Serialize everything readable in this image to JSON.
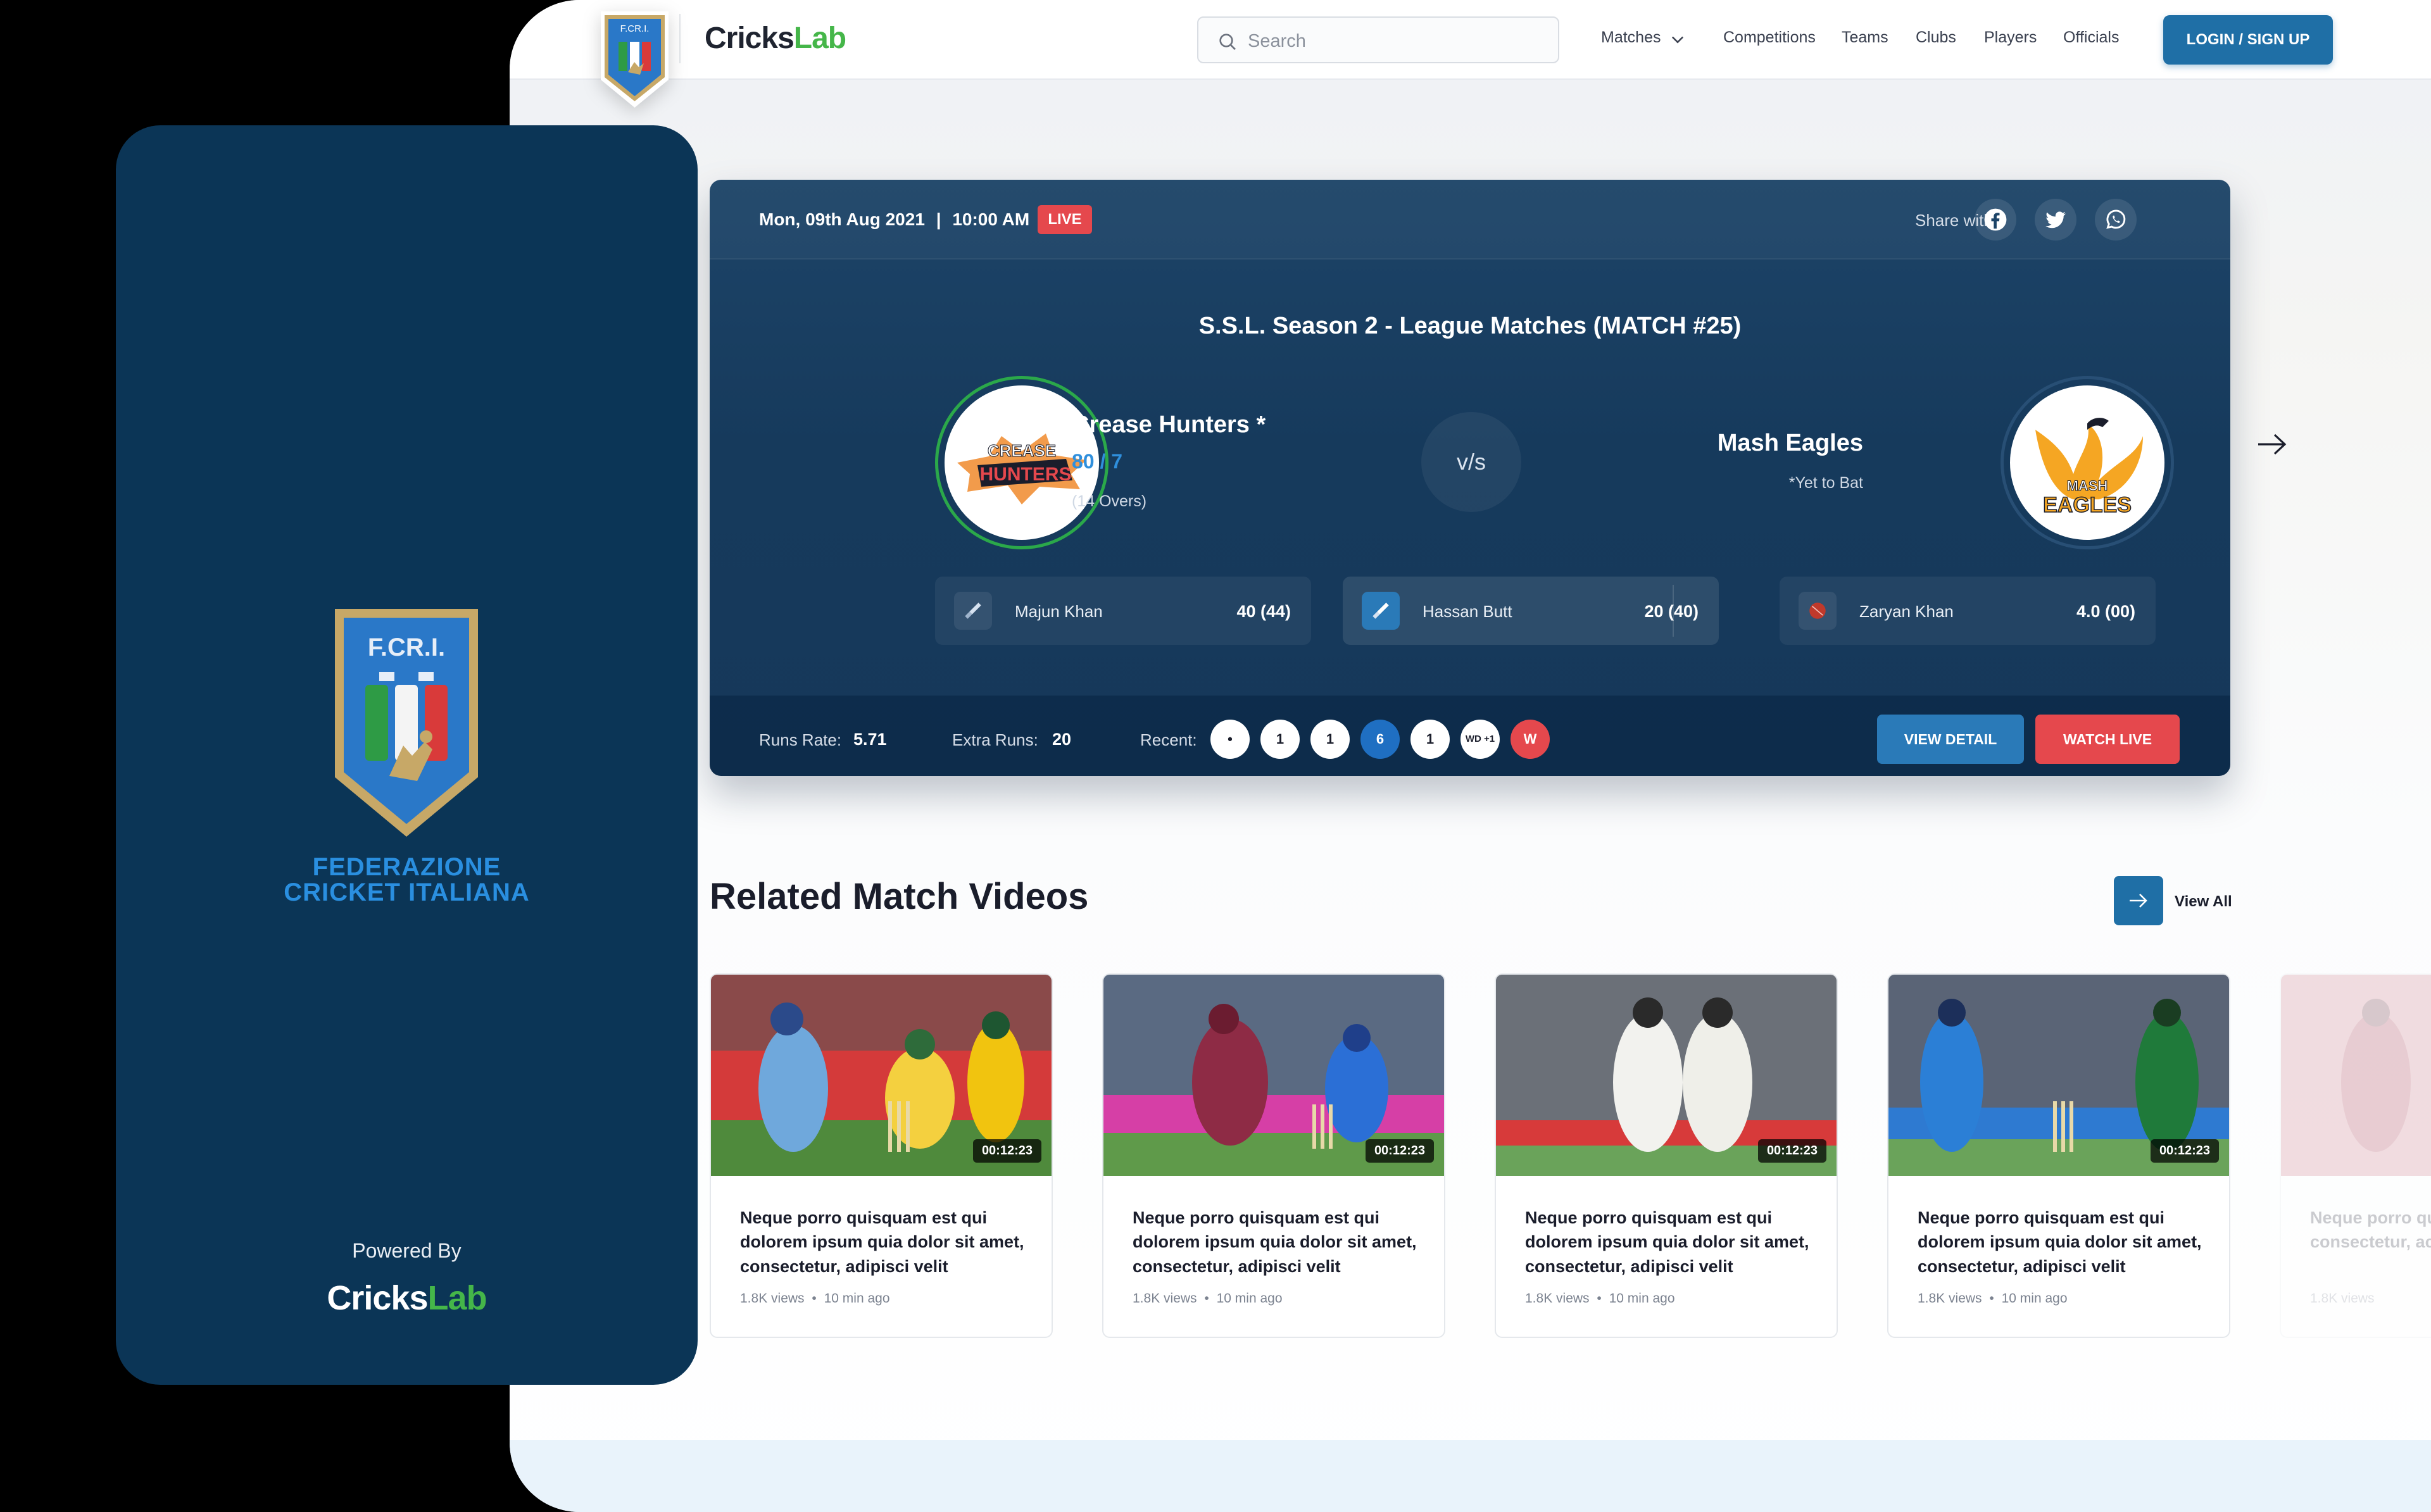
{
  "nav": {
    "brand_part1": "Cricks",
    "brand_part2": "Lab",
    "search_placeholder": "Search",
    "items": [
      "Matches",
      "Competitions",
      "Teams",
      "Clubs",
      "Players",
      "Officials"
    ],
    "login_label": "LOGIN / SIGN UP",
    "shield_text": "F.CR.I."
  },
  "match": {
    "date": "Mon, 09th Aug 2021",
    "time": "10:00 AM",
    "status": "LIVE",
    "share_label": "Share with:",
    "share_icons": [
      "facebook-icon",
      "twitter-icon",
      "whatsapp-icon"
    ],
    "title": "S.S.L. Season 2 - League Matches (MATCH #25)",
    "vs_label": "v/s",
    "team1": {
      "name": "Crease Hunters *",
      "score": "80 / 7",
      "overs": "(14 Overs)",
      "logo_top": "CREASE",
      "logo_bottom": "HUNTERS"
    },
    "team2": {
      "name": "Mash Eagles",
      "status": "*Yet to Bat",
      "logo_top": "MASH",
      "logo_bottom": "EAGLES"
    },
    "players": [
      {
        "name": "Majun Khan",
        "score": "40 (44)",
        "icon": "bat-icon"
      },
      {
        "name": "Hassan Butt",
        "score": "20 (40)",
        "icon": "bat-icon"
      },
      {
        "name": "Zaryan Khan",
        "score": "4.0 (00)",
        "icon": "ball-icon"
      }
    ],
    "runs_rate_label": "Runs Rate:",
    "runs_rate": "5.71",
    "extra_runs_label": "Extra Runs:",
    "extra_runs": "20",
    "recent_label": "Recent:",
    "recent": [
      "•",
      "1",
      "1",
      "6",
      "1",
      "WD +1",
      "W"
    ],
    "view_detail_label": "VIEW DETAIL",
    "watch_live_label": "WATCH LIVE"
  },
  "related": {
    "title": "Related Match Videos",
    "view_all_label": "View All",
    "videos": [
      {
        "title": "Neque porro quisquam est qui dolorem ipsum quia dolor sit amet, consectetur, adipisci velit",
        "duration": "00:12:23",
        "views": "1.8K views",
        "age": "10 min ago"
      },
      {
        "title": "Neque porro quisquam est qui dolorem ipsum quia dolor sit amet, consectetur, adipisci velit",
        "duration": "00:12:23",
        "views": "1.8K views",
        "age": "10 min ago"
      },
      {
        "title": "Neque porro quisquam est qui dolorem ipsum quia dolor sit amet, consectetur, adipisci velit",
        "duration": "00:12:23",
        "views": "1.8K views",
        "age": "10 min ago"
      },
      {
        "title": "Neque porro quisquam est qui dolorem ipsum quia dolor sit amet, consectetur, adipisci velit",
        "duration": "00:12:23",
        "views": "1.8K views",
        "age": "10 min ago"
      },
      {
        "title": "Neque porro qu dolorem ipsum consectetur, ac",
        "views": "1.8K views"
      }
    ]
  },
  "mobile": {
    "shield_text": "F.CR.I.",
    "federation_line1": "FEDERAZIONE",
    "federation_line2": "CRICKET ITALIANA",
    "powered_by": "Powered By",
    "brand_part1": "Cricks",
    "brand_part2": "Lab"
  },
  "colors": {
    "brand_blue": "#1f6fa6",
    "card_navy": "#163a5c",
    "live_red": "#e5484d",
    "brand_green": "#45b649",
    "mobile_bg": "#0b3556"
  }
}
